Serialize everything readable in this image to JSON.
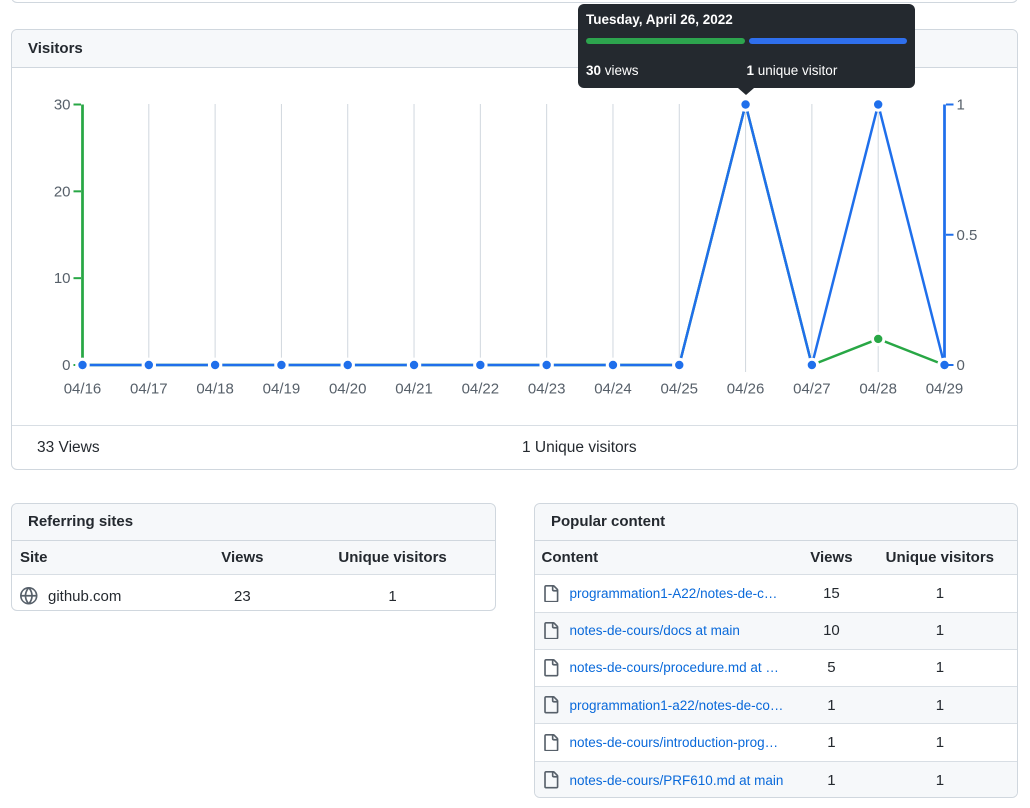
{
  "colors": {
    "page_background": "#ffffff",
    "card_border": "#d0d7de",
    "card_header_background": "#f6f8fa",
    "row_stripe": "#f6f8fa",
    "row_border": "#d8dee4",
    "text": "#24292f",
    "muted_text": "#57606a",
    "link": "#0969da",
    "views_green": "#28a745",
    "unique_blue": "#1f6feb",
    "tooltip_background": "#24292f"
  },
  "visitors_card": {
    "title": "Visitors",
    "summary_views": "33 Views",
    "summary_unique": "1 Unique visitors"
  },
  "tooltip": {
    "title": "Tuesday, April 26, 2022",
    "views_value": "30",
    "views_word": " views",
    "unique_value": "1",
    "unique_word": " unique visitor",
    "views_bar_color": "#2da44e",
    "unique_bar_color": "#2f6fed",
    "background": "#24292f"
  },
  "chart_data": {
    "type": "line",
    "categories": [
      "04/16",
      "04/17",
      "04/18",
      "04/19",
      "04/20",
      "04/21",
      "04/22",
      "04/23",
      "04/24",
      "04/25",
      "04/26",
      "04/27",
      "04/28",
      "04/29"
    ],
    "series": [
      {
        "name": "Views",
        "axis": "left",
        "color": "#28a745",
        "values": [
          0,
          0,
          0,
          0,
          0,
          0,
          0,
          0,
          0,
          0,
          30,
          0,
          3,
          0
        ]
      },
      {
        "name": "Unique visitors",
        "axis": "right",
        "color": "#1f6feb",
        "values": [
          0,
          0,
          0,
          0,
          0,
          0,
          0,
          0,
          0,
          0,
          1,
          0,
          1,
          0
        ]
      }
    ],
    "left_axis": {
      "range": [
        0,
        30
      ],
      "ticks": [
        0,
        10,
        20,
        30
      ],
      "labels": [
        "0",
        "10",
        "20",
        "30"
      ],
      "color": "#28a745"
    },
    "right_axis": {
      "range": [
        0,
        1
      ],
      "ticks": [
        0,
        0.5,
        1
      ],
      "labels": [
        "0",
        "0.5",
        "1"
      ],
      "color": "#1f6feb"
    },
    "grid": "vertical",
    "gridline_color": "#d0d7de",
    "tick_label_color": "#57606a"
  },
  "referring_sites": {
    "title": "Referring sites",
    "columns": [
      "Site",
      "Views",
      "Unique visitors"
    ],
    "row_icon": "globe-icon",
    "rows": [
      {
        "site": "github.com",
        "views": "23",
        "unique": "1"
      }
    ]
  },
  "popular_content": {
    "title": "Popular content",
    "columns": [
      "Content",
      "Views",
      "Unique visitors"
    ],
    "row_icon": "file-icon",
    "rows": [
      {
        "content": "programmation1-A22/notes-de-c…",
        "views": "15",
        "unique": "1"
      },
      {
        "content": "notes-de-cours/docs at main",
        "views": "10",
        "unique": "1"
      },
      {
        "content": "notes-de-cours/procedure.md at …",
        "views": "5",
        "unique": "1"
      },
      {
        "content": "programmation1-a22/notes-de-co…",
        "views": "1",
        "unique": "1"
      },
      {
        "content": "notes-de-cours/introduction-prog…",
        "views": "1",
        "unique": "1"
      },
      {
        "content": "notes-de-cours/PRF610.md at main",
        "views": "1",
        "unique": "1"
      }
    ]
  }
}
